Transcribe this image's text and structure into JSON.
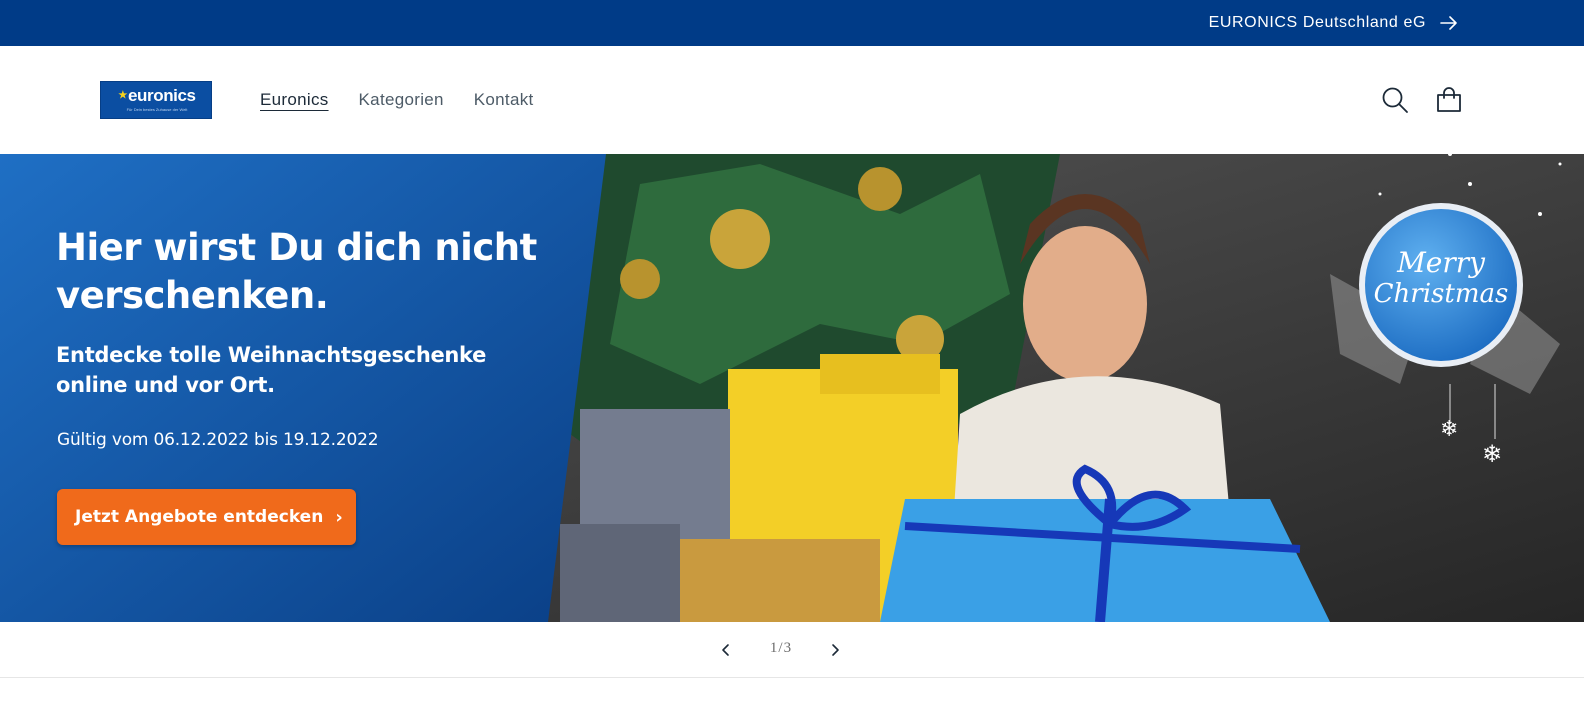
{
  "announcement": {
    "text": "EURONICS Deutschland eG",
    "icon": "arrow-right-icon"
  },
  "header": {
    "logo": {
      "word": "euronics",
      "tagline": "Für Dein bestes Zuhause der Welt"
    },
    "nav": [
      {
        "label": "Euronics",
        "active": true
      },
      {
        "label": "Kategorien",
        "active": false
      },
      {
        "label": "Kontakt",
        "active": false
      }
    ],
    "icons": [
      "search-icon",
      "cart-icon"
    ]
  },
  "hero": {
    "title_line1": "Hier wirst Du dich nicht",
    "title_line2": "verschenken.",
    "sub_line1": "Entdecke tolle Weihnachtsgeschenke",
    "sub_line2": "online und vor Ort.",
    "valid": "Gültig vom 06.12.2022 bis 19.12.2022",
    "cta_label": "Jetzt Angebote entdecken",
    "badge_line1": "Merry",
    "badge_line2": "Christmas",
    "colors": {
      "panel": "#1a5aa8",
      "cta": "#f06a1b",
      "badge": "#2f86d6"
    }
  },
  "slider": {
    "counter": "1/3",
    "prev_icon": "chevron-left-icon",
    "next_icon": "chevron-right-icon"
  }
}
